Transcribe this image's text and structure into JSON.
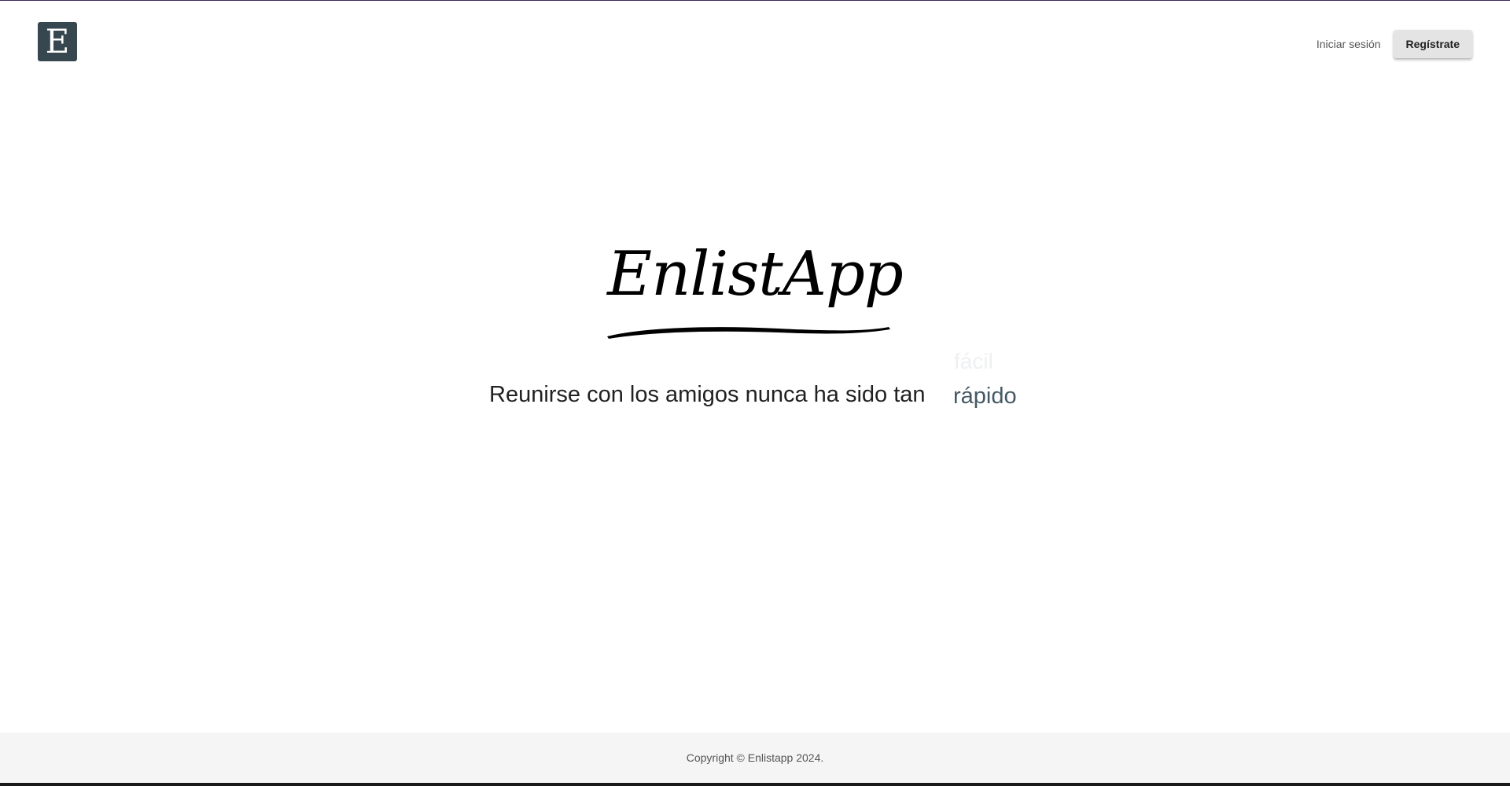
{
  "header": {
    "logo_letter": "E",
    "login_label": "Iniciar sesión",
    "register_label": "Regístrate"
  },
  "hero": {
    "wordmark": "EnlistApp",
    "tagline": "Reunirse con los amigos nunca ha sido tan",
    "rotating_words": {
      "previous": "fácil",
      "current": "rápido"
    }
  },
  "footer": {
    "copyright": "Copyright © Enlistapp 2024."
  },
  "colors": {
    "logo_bg": "#37474f",
    "accent_word": "#455a64",
    "footer_bg": "#f5f5f5",
    "button_bg": "#e4e4e4"
  }
}
